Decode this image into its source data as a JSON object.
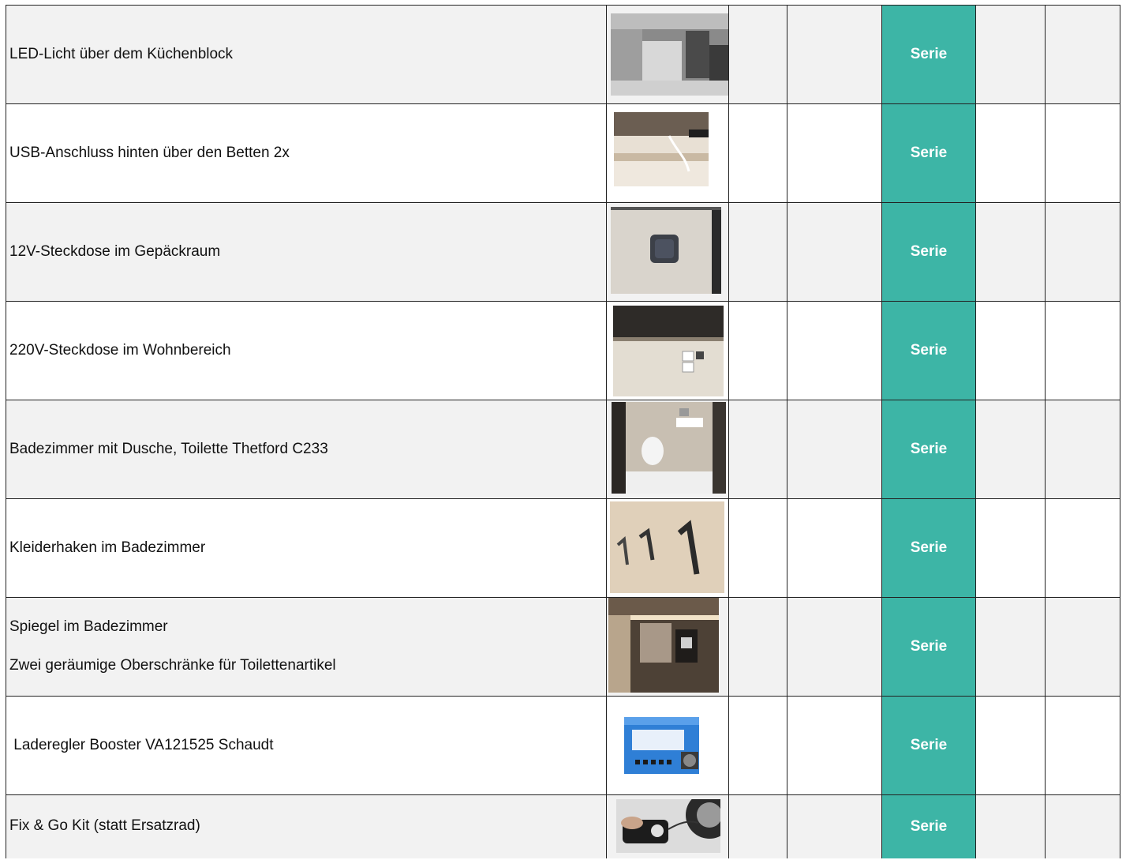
{
  "rows": [
    {
      "lines": [
        "LED-Licht über dem Küchenblock"
      ],
      "photo": "van-interior-photo",
      "status": "Serie"
    },
    {
      "lines": [
        "USB-Anschluss hinten über den Betten 2x"
      ],
      "photo": "usb-port-photo",
      "status": "Serie"
    },
    {
      "lines": [
        "12V-Steckdose im Gepäckraum"
      ],
      "photo": "12v-socket-photo",
      "status": "Serie"
    },
    {
      "lines": [
        "220V-Steckdose im Wohnbereich"
      ],
      "photo": "220v-socket-photo",
      "status": "Serie"
    },
    {
      "lines": [
        "Badezimmer mit Dusche, Toilette Thetford C233"
      ],
      "photo": "bathroom-photo",
      "status": "Serie"
    },
    {
      "lines": [
        "Kleiderhaken im Badezimmer"
      ],
      "photo": "clothes-hooks-photo",
      "status": "Serie"
    },
    {
      "lines": [
        "Spiegel im Badezimmer",
        "Zwei geräumige Oberschränke für Toilettenartikel"
      ],
      "photo": "mirror-cabinet-photo",
      "status": "Serie"
    },
    {
      "lines": [
        " Laderegler Booster VA121525 Schaudt"
      ],
      "photo": "charge-booster-photo",
      "status": "Serie"
    },
    {
      "lines": [
        "Fix & Go Kit (statt Ersatzrad)"
      ],
      "photo": "fix-go-kit-photo",
      "status": "Serie"
    }
  ],
  "colors": {
    "serie_bg": "#3db5a6",
    "shade_bg": "#f2f2f2",
    "border": "#222222"
  }
}
